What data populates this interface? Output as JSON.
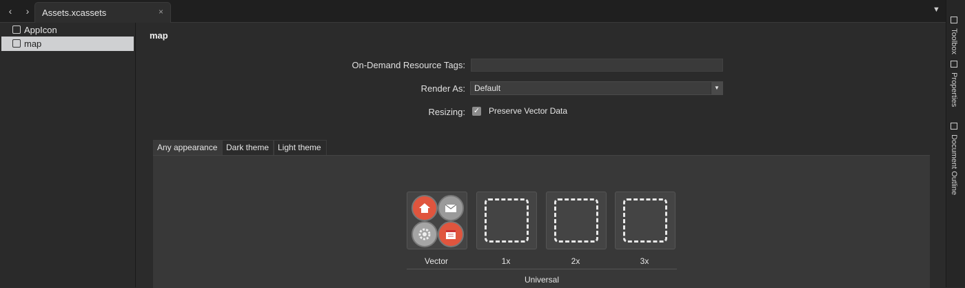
{
  "tabbar": {
    "back_icon": "‹",
    "forward_icon": "›",
    "tab_title": "Assets.xcassets",
    "close_icon": "×",
    "dropdown_icon": "▼"
  },
  "sidebar": {
    "items": [
      {
        "label": "AppIcon",
        "icon": "appicon-icon",
        "selected": false
      },
      {
        "label": "map",
        "icon": "image-icon",
        "selected": true
      }
    ]
  },
  "main": {
    "title": "map",
    "form": {
      "tags_label": "On-Demand Resource Tags:",
      "tags_value": "",
      "render_label": "Render As:",
      "render_value": "Default",
      "resizing_label": "Resizing:",
      "preserve_checked": true,
      "preserve_label": "Preserve Vector Data"
    },
    "tabs": [
      {
        "label": "Any appearance",
        "active": true
      },
      {
        "label": "Dark theme",
        "active": false
      },
      {
        "label": "Light theme",
        "active": false
      }
    ],
    "slots": [
      {
        "label": "Vector",
        "filled": true
      },
      {
        "label": "1x",
        "filled": false
      },
      {
        "label": "2x",
        "filled": false
      },
      {
        "label": "3x",
        "filled": false
      }
    ],
    "group_label": "Universal"
  },
  "right_toolbar": {
    "items": [
      {
        "label": "Toolbox",
        "icon": "toolbox-icon"
      },
      {
        "label": "Properties",
        "icon": "properties-icon"
      },
      {
        "label": "Document Outline",
        "icon": "document-outline-icon"
      }
    ]
  },
  "colors": {
    "accent_red": "#e0553e",
    "panel": "#383838",
    "selected_row": "#cfd0d2"
  }
}
